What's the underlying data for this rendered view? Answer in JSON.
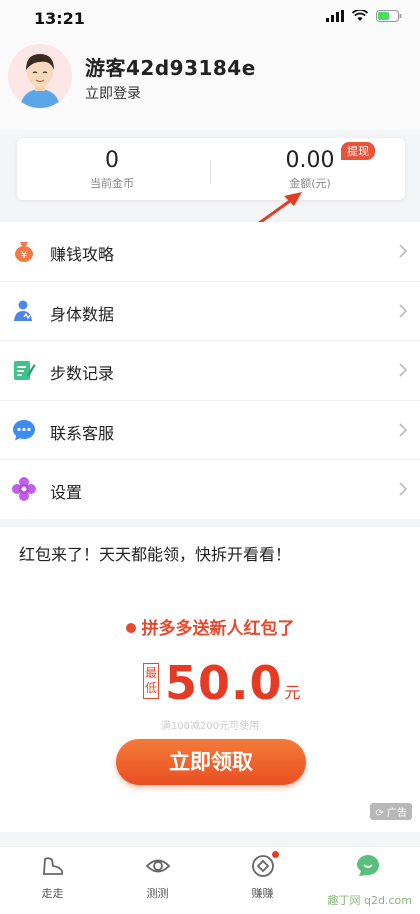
{
  "status_bar": {
    "time": "13:21"
  },
  "profile": {
    "username": "游客42d93184e",
    "login_label": "立即登录"
  },
  "wallet": {
    "coins_value": "0",
    "coins_label": "当前金币",
    "amount_value": "0.00",
    "amount_label": "金额(元)",
    "withdraw_label": "提现"
  },
  "menu": [
    {
      "label": "赚钱攻略",
      "icon": "money-bag-icon"
    },
    {
      "label": "身体数据",
      "icon": "body-data-icon"
    },
    {
      "label": "步数记录",
      "icon": "step-record-icon"
    },
    {
      "label": "联系客服",
      "icon": "chat-icon"
    },
    {
      "label": "设置",
      "icon": "flower-settings-icon"
    }
  ],
  "ad": {
    "headline": "红包来了！天天都能领，快拆开看看！",
    "promo": "拼多多送新人红包了",
    "min_tag": "最低",
    "amount": "50.0",
    "unit": "元",
    "condition": "满100减200元可使用",
    "button": "立即领取",
    "ad_mark": "广告"
  },
  "tabs": [
    {
      "label": "走走",
      "icon": "shoe-icon"
    },
    {
      "label": "测测",
      "icon": "eye-icon"
    },
    {
      "label": "赚赚",
      "icon": "diamond-icon"
    },
    {
      "label": "",
      "icon": "green-chat-icon"
    }
  ],
  "watermark": "趣丁网 q2d.com",
  "colors": {
    "accent": "#e64a2e",
    "button_top": "#f47b3a",
    "button_bottom": "#e94f22"
  }
}
